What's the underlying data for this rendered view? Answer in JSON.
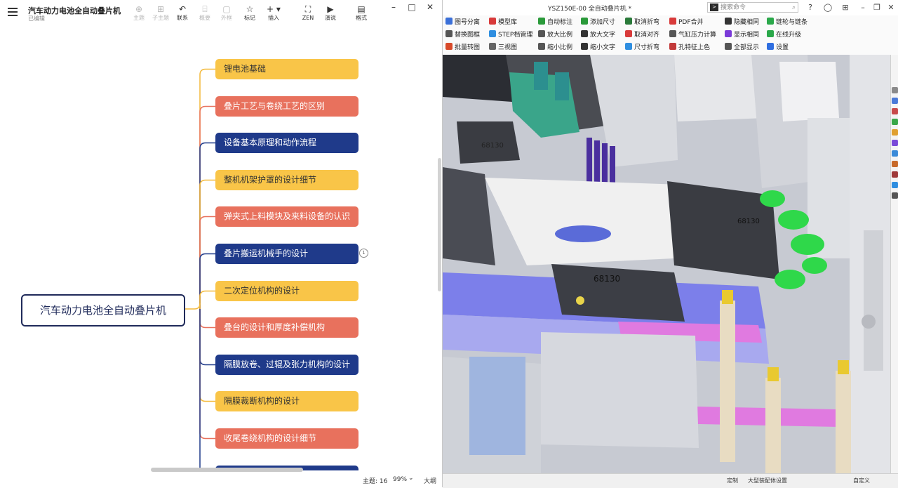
{
  "mindmap": {
    "doc_title": "汽车动力电池全自动叠片机",
    "doc_subtitle": "已编辑",
    "toolbar": [
      {
        "name": "topic",
        "icon": "⊕",
        "label": "主题",
        "enabled": false
      },
      {
        "name": "subtopic",
        "icon": "⊞",
        "label": "子主题",
        "enabled": false
      },
      {
        "name": "relation",
        "icon": "↶",
        "label": "联系",
        "enabled": true
      },
      {
        "name": "summary",
        "icon": "⌸",
        "label": "概要",
        "enabled": false
      },
      {
        "name": "boundary",
        "icon": "▢",
        "label": "外框",
        "enabled": false
      },
      {
        "name": "marker",
        "icon": "☆",
        "label": "标记",
        "enabled": true
      },
      {
        "name": "insert",
        "icon": "+ ▾",
        "label": "插入",
        "enabled": true
      },
      {
        "name": "zen",
        "icon": "⛶",
        "label": "ZEN",
        "enabled": true
      },
      {
        "name": "present",
        "icon": "▶",
        "label": "演说",
        "enabled": true
      },
      {
        "name": "format",
        "icon": "▤",
        "label": "格式",
        "enabled": true
      }
    ],
    "root": "汽车动力电池全自动叠片机",
    "branches": [
      {
        "label": "锂电池基础",
        "color": "yellow"
      },
      {
        "label": "叠片工艺与卷绕工艺的区别",
        "color": "red"
      },
      {
        "label": "设备基本原理和动作流程",
        "color": "blue"
      },
      {
        "label": "整机机架护罩的设计细节",
        "color": "yellow"
      },
      {
        "label": "弹夹式上料模块及来料设备的认识",
        "color": "red"
      },
      {
        "label": "叠片搬运机械手的设计",
        "color": "blue"
      },
      {
        "label": "二次定位机构的设计",
        "color": "yellow"
      },
      {
        "label": "叠台的设计和厚度补偿机构",
        "color": "red"
      },
      {
        "label": "隔膜放卷、过辊及张力机构的设计",
        "color": "blue"
      },
      {
        "label": "隔膜裁断机构的设计",
        "color": "yellow"
      },
      {
        "label": "收尾卷绕机构的设计细节",
        "color": "red"
      },
      {
        "label": "",
        "color": "blue"
      }
    ],
    "collapsed_badge": "1",
    "status": {
      "topics": "主题: 16",
      "zoom": "99%",
      "zoom_caret": "⌄",
      "outline": "大纲"
    }
  },
  "cad": {
    "title": "YSZ150E-00 全自动叠片机 *",
    "search_placeholder": "搜索命令",
    "ribbon": [
      {
        "label": "图号分离",
        "icon_color": "#3a6fd8"
      },
      {
        "label": "替换图框",
        "icon_color": "#555"
      },
      {
        "label": "批量转图",
        "icon_color": "#d84a2a"
      },
      {
        "label": "模型库",
        "icon_color": "#d83a3a"
      },
      {
        "label": "STEP档管理",
        "icon_color": "#2f8ee0"
      },
      {
        "label": "三视图",
        "icon_color": "#666"
      },
      {
        "label": "自动标注",
        "icon_color": "#2a9a3a"
      },
      {
        "label": "放大比例",
        "icon_color": "#555"
      },
      {
        "label": "缩小比例",
        "icon_color": "#555"
      },
      {
        "label": "添加尺寸",
        "icon_color": "#2a9a3a"
      },
      {
        "label": "放大文字",
        "icon_color": "#333"
      },
      {
        "label": "缩小文字",
        "icon_color": "#333"
      },
      {
        "label": "取消折弯",
        "icon_color": "#2a7a3a"
      },
      {
        "label": "取消对齐",
        "icon_color": "#d83a3a"
      },
      {
        "label": "尺寸折弯",
        "icon_color": "#2f8ee0"
      },
      {
        "label": "PDF合并",
        "icon_color": "#d83a3a"
      },
      {
        "label": "气缸压力计算",
        "icon_color": "#555"
      },
      {
        "label": "孔特征上色",
        "icon_color": "#c23a3a"
      },
      {
        "label": "隐藏相同",
        "icon_color": "#333"
      },
      {
        "label": "显示相同",
        "icon_color": "#7a3ad8"
      },
      {
        "label": "全部显示",
        "icon_color": "#555"
      },
      {
        "label": "链轮与链条",
        "icon_color": "#2aa84a"
      },
      {
        "label": "在线升级",
        "icon_color": "#2aa84a"
      },
      {
        "label": "设置",
        "icon_color": "#2f6ee0"
      }
    ],
    "part_label_1": "68130",
    "part_label_2": "68130",
    "part_label_3": "68130",
    "status": {
      "left": "定制",
      "middle": "大型装配体设置",
      "right": "自定义"
    }
  }
}
